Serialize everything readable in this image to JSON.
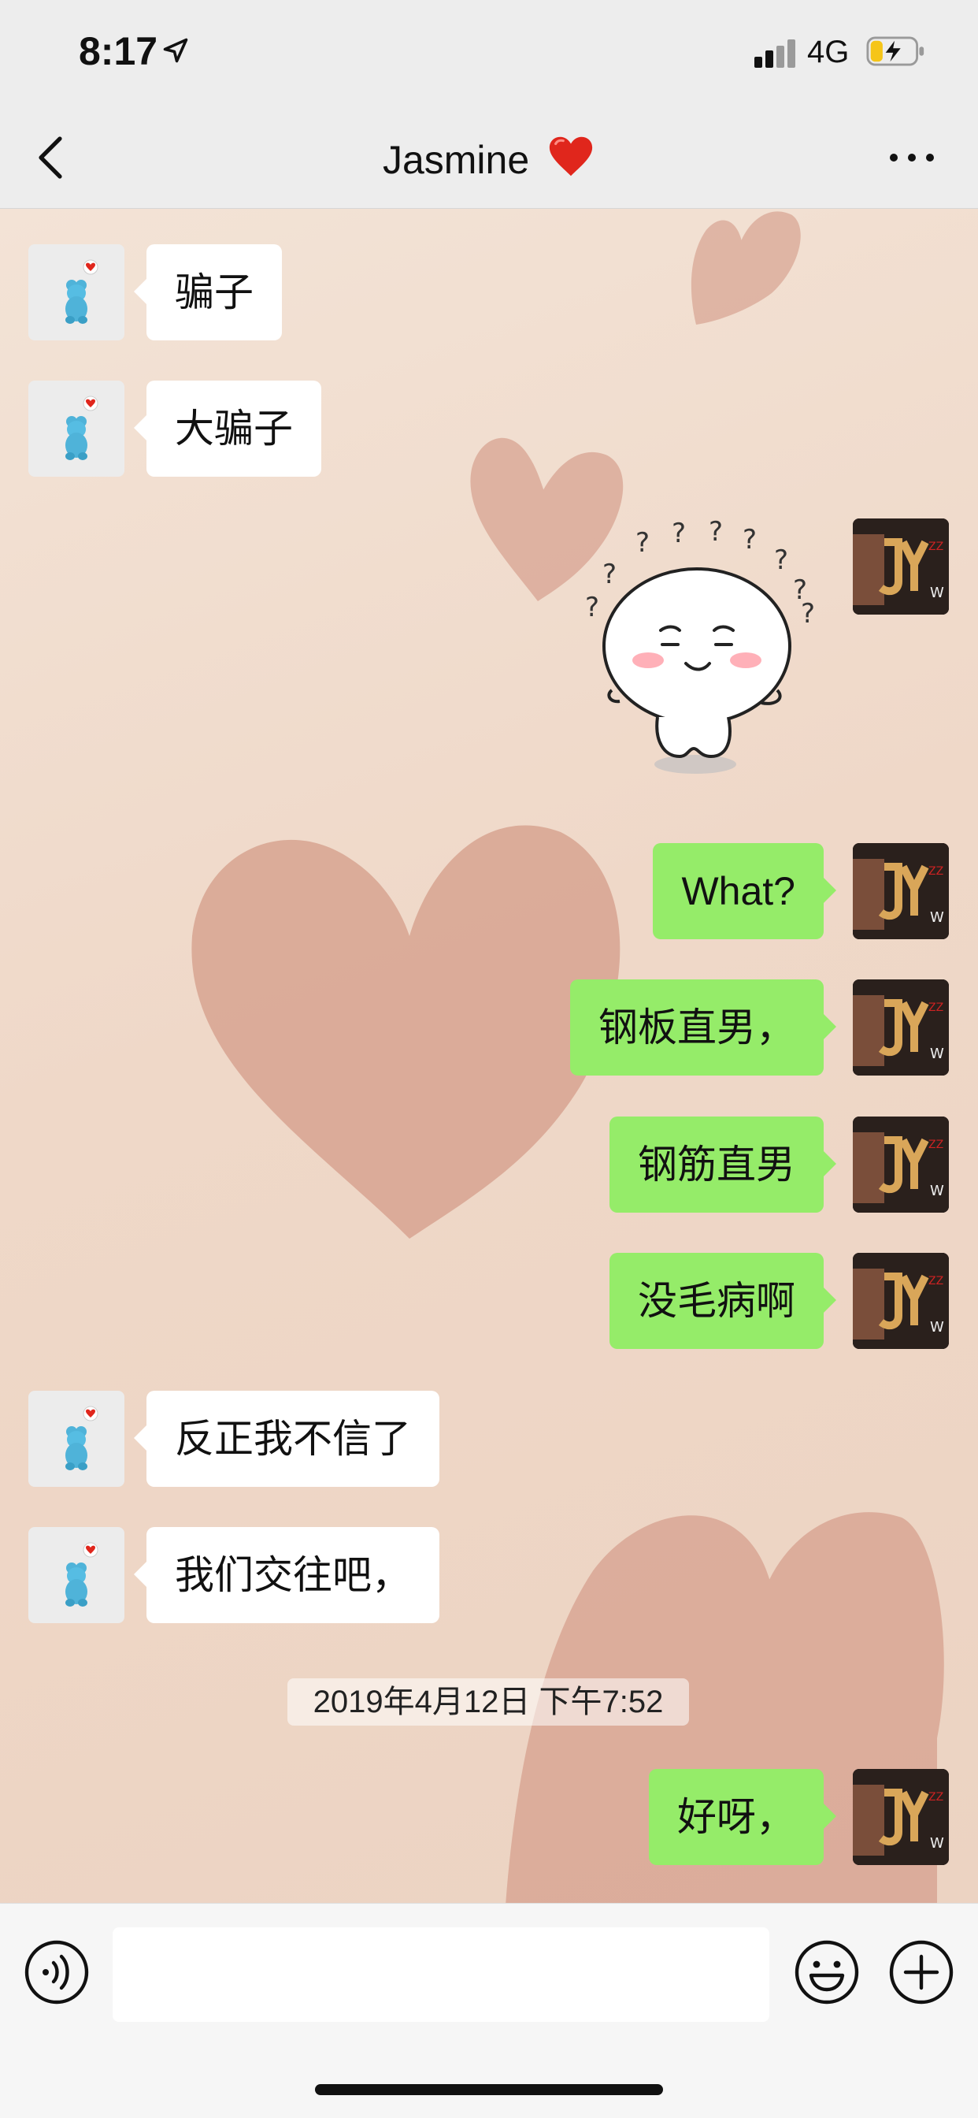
{
  "status_bar": {
    "time": "8:17",
    "network": "4G",
    "icons": [
      "location-arrow-icon",
      "signal-icon",
      "battery-charging-icon"
    ]
  },
  "nav": {
    "title": "Jasmine",
    "title_emoji": "heart-icon",
    "back_icon": "chevron-left-icon",
    "more_icon": "more-dots-icon"
  },
  "messages": [
    {
      "side": "left",
      "text": "骗子"
    },
    {
      "side": "left",
      "text": "大骗子"
    },
    {
      "side": "right",
      "type": "sticker",
      "sticker": "confused-face-sticker"
    },
    {
      "side": "right",
      "text": "What?"
    },
    {
      "side": "right",
      "text": "钢板直男，"
    },
    {
      "side": "right",
      "text": "钢筋直男"
    },
    {
      "side": "right",
      "text": "没毛病啊"
    },
    {
      "side": "left",
      "text": "反正我不信了"
    },
    {
      "side": "left",
      "text": "我们交往吧，"
    },
    {
      "type": "timestamp",
      "text": "2019年4月12日 下午7:52"
    },
    {
      "side": "right",
      "text": "好呀，"
    }
  ],
  "input_bar": {
    "value": "",
    "icons": [
      "voice-icon",
      "emoji-icon",
      "plus-icon"
    ]
  },
  "colors": {
    "own_bubble": "#95ec69",
    "other_bubble": "#ffffff",
    "bar_bg": "#ededed"
  }
}
